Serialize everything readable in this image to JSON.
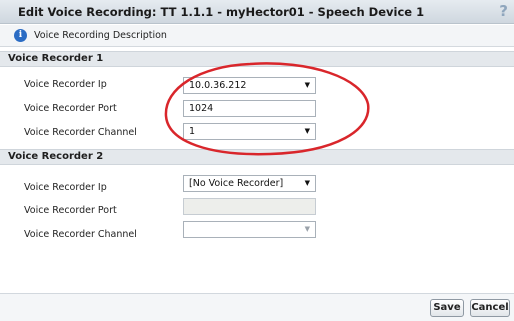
{
  "window": {
    "title": "Edit Voice Recording: TT 1.1.1 - myHector01 - Speech Device 1",
    "help_glyph": "?"
  },
  "description_bar": {
    "info_glyph": "i",
    "label": "Voice Recording Description"
  },
  "recorder1": {
    "header": "Voice Recorder 1",
    "ip_label": "Voice Recorder Ip",
    "ip_value": "10.0.36.212",
    "port_label": "Voice Recorder Port",
    "port_value": "1024",
    "channel_label": "Voice Recorder Channel",
    "channel_value": "1"
  },
  "recorder2": {
    "header": "Voice Recorder 2",
    "ip_label": "Voice Recorder Ip",
    "ip_value": "[No Voice Recorder]",
    "port_label": "Voice Recorder Port",
    "port_value": "",
    "channel_label": "Voice Recorder Channel",
    "channel_value": ""
  },
  "footer": {
    "save_label": "Save",
    "cancel_label": "Cancel"
  },
  "icons": {
    "help": "help-icon",
    "info": "info-icon",
    "dropdown": "chevron-down-icon"
  },
  "colors": {
    "annotation_ellipse": "#d9262b",
    "info_icon": "#2b6cc4"
  }
}
